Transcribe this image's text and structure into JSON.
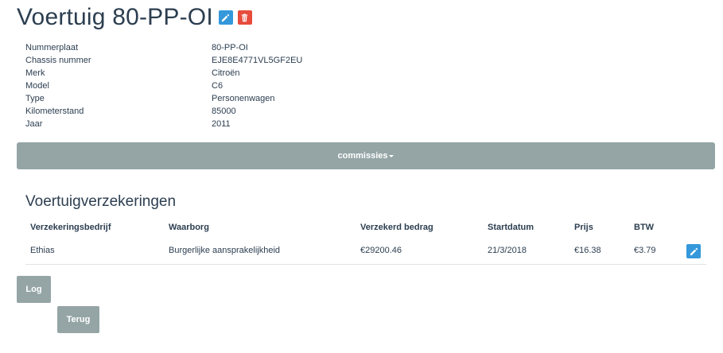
{
  "header": {
    "title": "Voertuig 80-PP-OI",
    "edit_icon": "pencil-icon",
    "delete_icon": "trash-icon",
    "edit_color": "#3498db",
    "delete_color": "#e74c3c"
  },
  "details": [
    {
      "label": "Nummerplaat",
      "value": "80-PP-OI"
    },
    {
      "label": "Chassis nummer",
      "value": "EJE8E4771VL5GF2EU"
    },
    {
      "label": "Merk",
      "value": "Citroën"
    },
    {
      "label": "Model",
      "value": "C6"
    },
    {
      "label": "Type",
      "value": "Personenwagen"
    },
    {
      "label": "Kilometerstand",
      "value": "85000"
    },
    {
      "label": "Jaar",
      "value": "2011"
    }
  ],
  "commissies": {
    "label": "commissies",
    "icon": "caret-down-icon",
    "color": "#95a5a6"
  },
  "insurances": {
    "title": "Voertuigverzekeringen",
    "columns": [
      "Verzekeringsbedrijf",
      "Waarborg",
      "Verzekerd bedrag",
      "Startdatum",
      "Prijs",
      "BTW"
    ],
    "rows": [
      {
        "company": "Ethias",
        "coverage": "Burgerlijke aansprakelijkheid",
        "amount": "€29200.46",
        "start": "21/3/2018",
        "price": "€16.38",
        "vat": "€3.79",
        "edit_icon": "pencil-icon"
      }
    ]
  },
  "buttons": {
    "log": "Log",
    "back": "Terug"
  }
}
